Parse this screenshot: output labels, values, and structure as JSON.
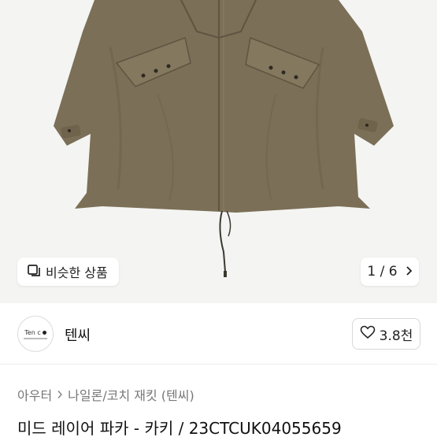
{
  "gallery": {
    "similar_label": "비슷한 상품",
    "counter": "1 / 6"
  },
  "shop": {
    "logo_text": "Ten c",
    "name": "텐씨",
    "likes": "3.8천"
  },
  "breadcrumb": {
    "items": [
      "아우터",
      "나일론/코치 재킷 (텐씨)"
    ]
  },
  "product": {
    "title": "미드 레이어 파카 - 카키 / 23CTCUK04055659"
  },
  "colors": {
    "jacket": "#7b6f57",
    "background": "#f4f4f2"
  }
}
